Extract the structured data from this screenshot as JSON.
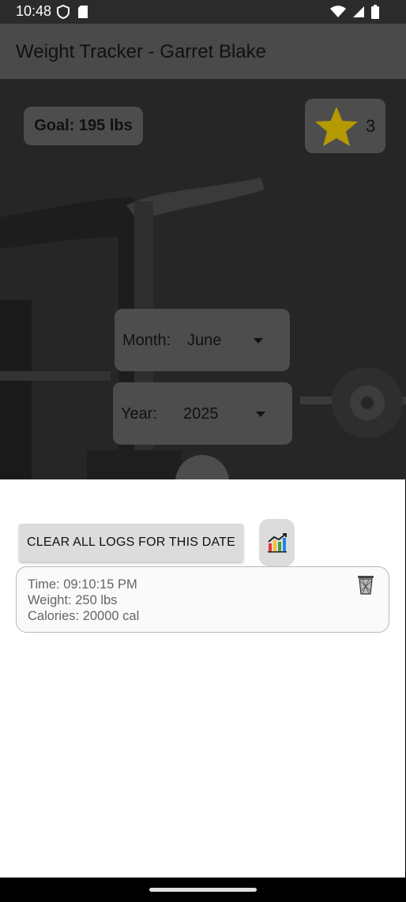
{
  "status_bar": {
    "time": "10:48",
    "left_icons": [
      "shield-icon",
      "sd-card-icon"
    ],
    "right_icons": [
      "wifi-icon",
      "signal-icon",
      "battery-icon"
    ]
  },
  "app_bar": {
    "title": "Weight Tracker - Garret Blake"
  },
  "goal": {
    "label": "Goal: 195 lbs"
  },
  "streak": {
    "icon": "star-icon",
    "count": "3",
    "star_color": "#b49a00"
  },
  "month_picker": {
    "label": "Month:",
    "value": "June"
  },
  "year_picker": {
    "label": "Year:",
    "value": "2025"
  },
  "actions": {
    "clear_label": "CLEAR ALL LOGS FOR THIS DATE",
    "chart_icon": "bar-chart-icon"
  },
  "logs": [
    {
      "time": "Time: 09:10:15 PM",
      "weight": "Weight: 250 lbs",
      "calories": "Calories: 20000 cal",
      "delete_icon": "trash-icon"
    }
  ],
  "colors": {
    "app_bar": "#4a4a4a",
    "overlay_card": "#4d4d4d",
    "content_bg": "#ffffff",
    "button_bg": "#dcdcdc"
  }
}
